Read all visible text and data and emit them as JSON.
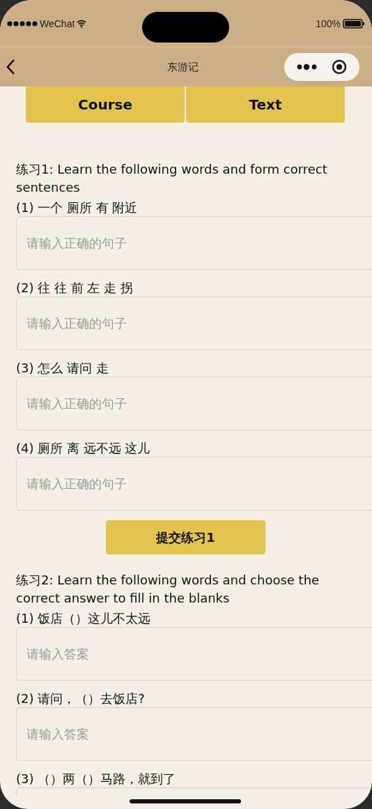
{
  "status_bar": {
    "carrier": "WeChat",
    "battery": "100%"
  },
  "nav_bar": {
    "title": "东游记"
  },
  "tabs": [
    {
      "label": "Course"
    },
    {
      "label": "Text"
    }
  ],
  "exercises": [
    {
      "title": "练习1: Learn the following words and form correct sentences",
      "questions": [
        {
          "prompt": "(1) 一个 厕所 有 附近",
          "placeholder": "请输入正确的句子"
        },
        {
          "prompt": "(2) 往 往 前 左 走 拐",
          "placeholder": "请输入正确的句子"
        },
        {
          "prompt": "(3) 怎么 请问 走",
          "placeholder": "请输入正确的句子"
        },
        {
          "prompt": "(4) 厕所 离 远不远 这儿",
          "placeholder": "请输入正确的句子"
        }
      ],
      "submit": "提交练习1"
    },
    {
      "title": "练习2: Learn the following words and choose the correct answer to fill in the blanks",
      "questions": [
        {
          "prompt": "(1) 饭店（）这儿不太远",
          "placeholder": "请输入答案"
        },
        {
          "prompt": "(2) 请问，（）去饭店?",
          "placeholder": "请输入答案"
        },
        {
          "prompt": "(3) （）两（）马路，就到了"
        }
      ]
    }
  ]
}
